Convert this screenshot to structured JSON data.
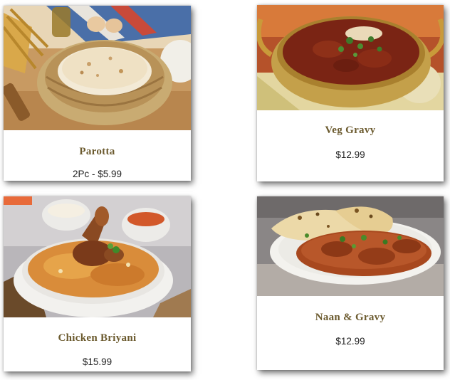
{
  "menu": {
    "items": [
      {
        "name": "Parotta",
        "price": "2Pc - $5.99",
        "image": "parotta-photo"
      },
      {
        "name": "Veg Gravy",
        "price": "$12.99",
        "image": "veg-gravy-photo"
      },
      {
        "name": "Chicken Briyani",
        "price": "$15.99",
        "image": "chicken-briyani-photo"
      },
      {
        "name": "Naan & Gravy",
        "price": "$12.99",
        "image": "naan-gravy-photo"
      }
    ]
  },
  "colors": {
    "title_text": "#6b5a2e",
    "price_text": "#222222",
    "card_background": "#ffffff"
  }
}
